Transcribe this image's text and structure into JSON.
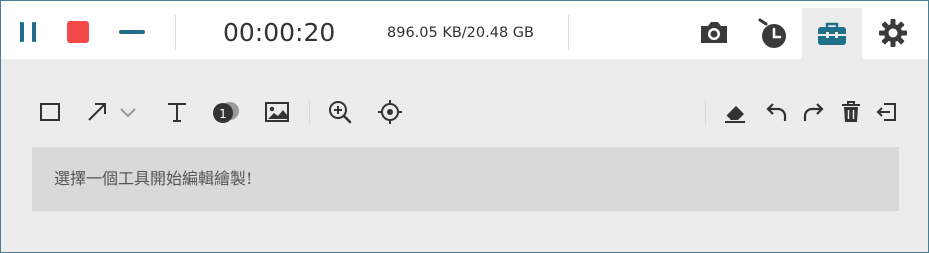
{
  "recording_bar": {
    "timer": "00:00:20",
    "storage": "896.05 KB/20.48 GB",
    "colors": {
      "accent": "#1f6f8b",
      "stop": "#f24a4a",
      "icon": "#3a3a3a"
    },
    "controls": [
      "pause-icon",
      "stop-icon",
      "minimize-icon"
    ],
    "right_icons": [
      "camera-icon",
      "clock-icon",
      "toolbox-icon",
      "gear-icon"
    ]
  },
  "draw_toolbar": {
    "tools_left": [
      "rectangle-icon",
      "arrow-icon",
      "chevron-down-icon",
      "text-icon",
      "number-marker-icon",
      "image-icon",
      "zoom-in-icon",
      "spotlight-icon"
    ],
    "badge_number": "1",
    "tools_right": [
      "eraser-icon",
      "undo-icon",
      "redo-icon",
      "trash-icon",
      "exit-icon"
    ]
  },
  "hint": {
    "text": "選擇一個工具開始編輯繪製!"
  }
}
